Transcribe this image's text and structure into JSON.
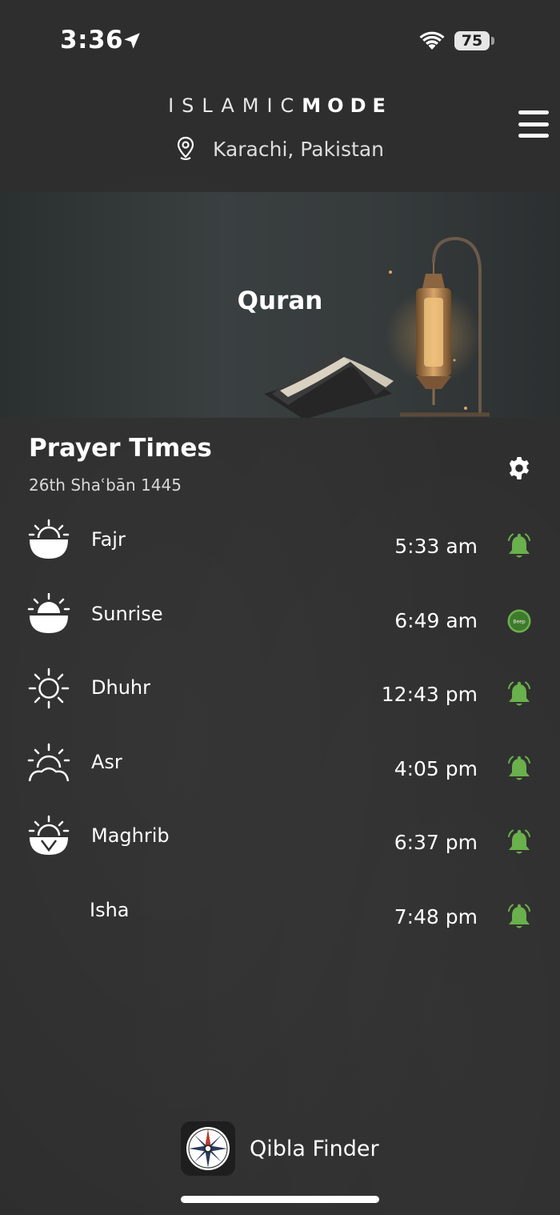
{
  "status_bar": {
    "time": "3:36",
    "battery": "75"
  },
  "header": {
    "brand_light": "ISLAMIC",
    "brand_bold": "MODE",
    "location": "Karachi, Pakistan"
  },
  "hero": {
    "title": "Quran"
  },
  "prayer": {
    "title": "Prayer Times",
    "hijri_date": "26th Shaʿbān 1445",
    "items": [
      {
        "name": "Fajr",
        "time": "5:33 am",
        "icon": "dawn-icon",
        "alert": "bell"
      },
      {
        "name": "Sunrise",
        "time": "6:49 am",
        "icon": "sunrise-icon",
        "alert": "beep"
      },
      {
        "name": "Dhuhr",
        "time": "12:43 pm",
        "icon": "sun-icon",
        "alert": "bell"
      },
      {
        "name": "Asr",
        "time": "4:05 pm",
        "icon": "afternoon-sun-icon",
        "alert": "bell"
      },
      {
        "name": "Maghrib",
        "time": "6:37 pm",
        "icon": "sunset-icon",
        "alert": "bell"
      },
      {
        "name": "Isha",
        "time": "7:48 pm",
        "icon": "moon-icon",
        "alert": "bell"
      }
    ],
    "beep_label": "Beep"
  },
  "qibla": {
    "label": "Qibla Finder"
  },
  "colors": {
    "background": "#2e2e2e",
    "accent_green": "#6ab04c",
    "text": "#ffffff"
  }
}
